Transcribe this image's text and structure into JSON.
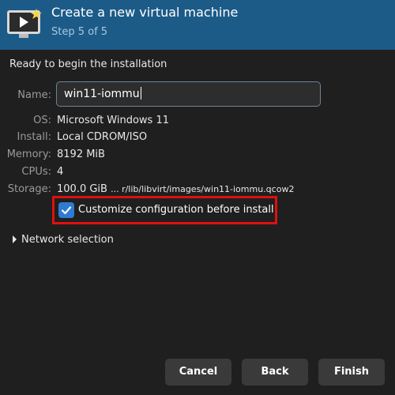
{
  "header": {
    "title": "Create a new virtual machine",
    "step": "Step 5 of 5",
    "icon": "virtual-machine-monitor-icon"
  },
  "summary": {
    "ready_text": "Ready to begin the installation",
    "name_label": "Name:",
    "name_value": "win11-iommu",
    "os_label": "OS:",
    "os_value": "Microsoft Windows 11",
    "install_label": "Install:",
    "install_value": "Local CDROM/ISO",
    "memory_label": "Memory:",
    "memory_value": "8192 MiB",
    "cpus_label": "CPUs:",
    "cpus_value": "4",
    "storage_label": "Storage:",
    "storage_size": "100.0 GiB",
    "storage_path": "... r/lib/libvirt/images/win11-iommu.qcow2"
  },
  "customize": {
    "label": "Customize configuration before install",
    "checked": true
  },
  "network": {
    "label": "Network selection",
    "expanded": false
  },
  "buttons": {
    "cancel": "Cancel",
    "back": "Back",
    "finish": "Finish"
  },
  "colors": {
    "header_bg": "#1c5b88",
    "window_bg": "#1f1f1f",
    "accent": "#2f7bd1",
    "highlight": "#e01010",
    "button_bg": "#3a3a3a"
  }
}
